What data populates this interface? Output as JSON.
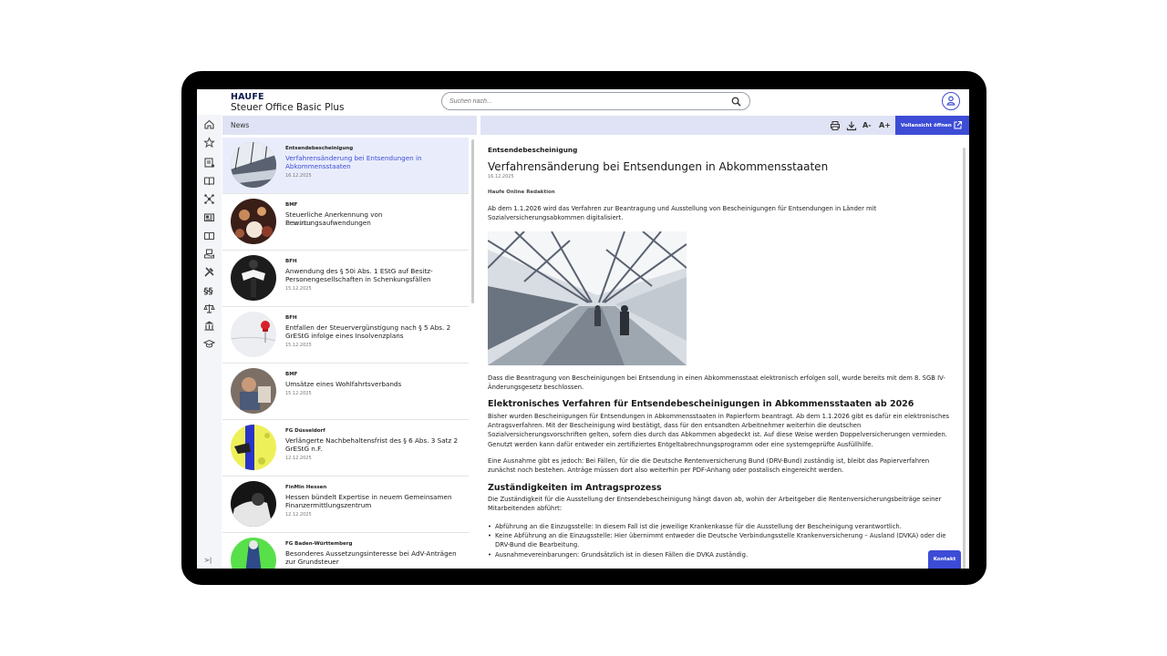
{
  "brand": {
    "logo": "HAUFE",
    "product": "Steuer Office Basic Plus"
  },
  "search": {
    "placeholder": "Suchen nach..."
  },
  "rail": {
    "icons": [
      "home-icon",
      "star-icon",
      "document-list-icon",
      "book-open-icon",
      "network-icon",
      "newspaper-icon",
      "book-icon",
      "box-hand-icon",
      "tools-icon",
      "paragraph-icon",
      "scales-icon",
      "bank-icon",
      "graduation-cap-icon"
    ],
    "collapse_label": ">|"
  },
  "news": {
    "header": "News",
    "items": [
      {
        "category": "Entsendebescheinigung",
        "title": "Verfahrensänderung bei Entsendungen in Abkommensstaaten",
        "date": "16.12.2025"
      },
      {
        "category": "BMF",
        "title": "Steuerliche Anerkennung von Bewirtungsaufwendungen",
        "date": "16.12.2025"
      },
      {
        "category": "BFH",
        "title": "Anwendung des § 50i Abs. 1 EStG auf Besitz-Personengesellschaften in Schenkungsfällen",
        "date": "15.12.2025"
      },
      {
        "category": "BFH",
        "title": "Entfallen der Steuervergünstigung nach § 5 Abs. 2 GrEStG infolge eines Insolvenzplans",
        "date": "15.12.2025"
      },
      {
        "category": "BMF",
        "title": "Umsätze eines Wohlfahrtsverbands",
        "date": "15.12.2025"
      },
      {
        "category": "FG Düsseldorf",
        "title": "Verlängerte Nachbehaltensfrist des § 6 Abs. 3 Satz 2 GrEStG n.F.",
        "date": "12.12.2025"
      },
      {
        "category": "FinMin Hessen",
        "title": "Hessen bündelt Expertise in neuem Gemeinsamen Finanzermittlungszentrum",
        "date": "12.12.2025"
      },
      {
        "category": "FG Baden-Württemberg",
        "title": "Besonderes Aussetzungsinteresse bei AdV-Anträgen zur Grundsteuer",
        "date": ""
      }
    ]
  },
  "toolbar": {
    "font_smaller": "A-",
    "font_larger": "A+",
    "open_full": "Vollansicht öffnen"
  },
  "article": {
    "category": "Entsendebescheinigung",
    "title": "Verfahrensänderung bei Entsendungen in Abkommensstaaten",
    "date": "16.12.2025",
    "author": "Haufe Online Redaktion",
    "intro": "Ab dem 1.1.2026 wird das Verfahren zur Beantragung und Ausstellung von Bescheinigungen für Entsendungen in Länder mit Sozialversicherungsabkommen digitalisiert.",
    "p1": "Dass die Beantragung von Bescheinigungen bei Entsendung in einen Abkommensstaat elektronisch erfolgen soll, wurde bereits mit dem 8. SGB IV-Änderungsgesetz beschlossen.",
    "h2_1": "Elektronisches Verfahren für Entsendebescheinigungen in Abkommensstaaten ab 2026",
    "p2": "Bisher wurden Bescheinigungen für Entsendungen in Abkommensstaaten in Papierform beantragt. Ab dem 1.1.2026 gibt es dafür ein elektronisches Antragsverfahren. Mit der Bescheinigung wird bestätigt, dass für den entsandten Arbeitnehmer weiterhin die deutschen Sozialversicherungsvorschriften gelten, sofern dies durch das Abkommen abgedeckt ist. Auf diese Weise werden Doppelversicherungen vermieden. Genutzt werden kann dafür entweder ein zertifiziertes Entgeltabrechnungsprogramm oder eine systemgeprüfte Ausfüllhilfe.",
    "p3": "Eine Ausnahme gibt es jedoch: Bei Fällen, für die die Deutsche Rentenversicherung Bund (DRV-Bund) zuständig ist, bleibt das Papierverfahren zunächst noch bestehen. Anträge müssen dort also weiterhin per PDF-Anhang oder postalisch eingereicht werden.",
    "h2_2": "Zuständigkeiten im Antragsprozess",
    "p4": "Die Zuständigkeit für die Ausstellung der Entsendebescheinigung hängt davon ab, wohin der Arbeitgeber die Rentenversicherungsbeiträge seiner Mitarbeitenden abführt:",
    "bullets": [
      "Abführung an die Einzugsstelle: In diesem Fall ist die jeweilige Krankenkasse für die Ausstellung der Bescheinigung verantwortlich.",
      "Keine Abführung an die Einzugsstelle: Hier übernimmt entweder die Deutsche Verbindungsstelle Krankenversicherung – Ausland (DVKA) oder die DRV-Bund die Bearbeitung.",
      "Ausnahmevereinbarungen: Grundsätzlich ist in diesen Fällen die DVKA zuständig."
    ]
  },
  "kontakt": "Kontakt",
  "colors": {
    "accent": "#3d4cd6",
    "panel_header": "#dfe3f5",
    "brand_navy": "#0d1b4d"
  }
}
